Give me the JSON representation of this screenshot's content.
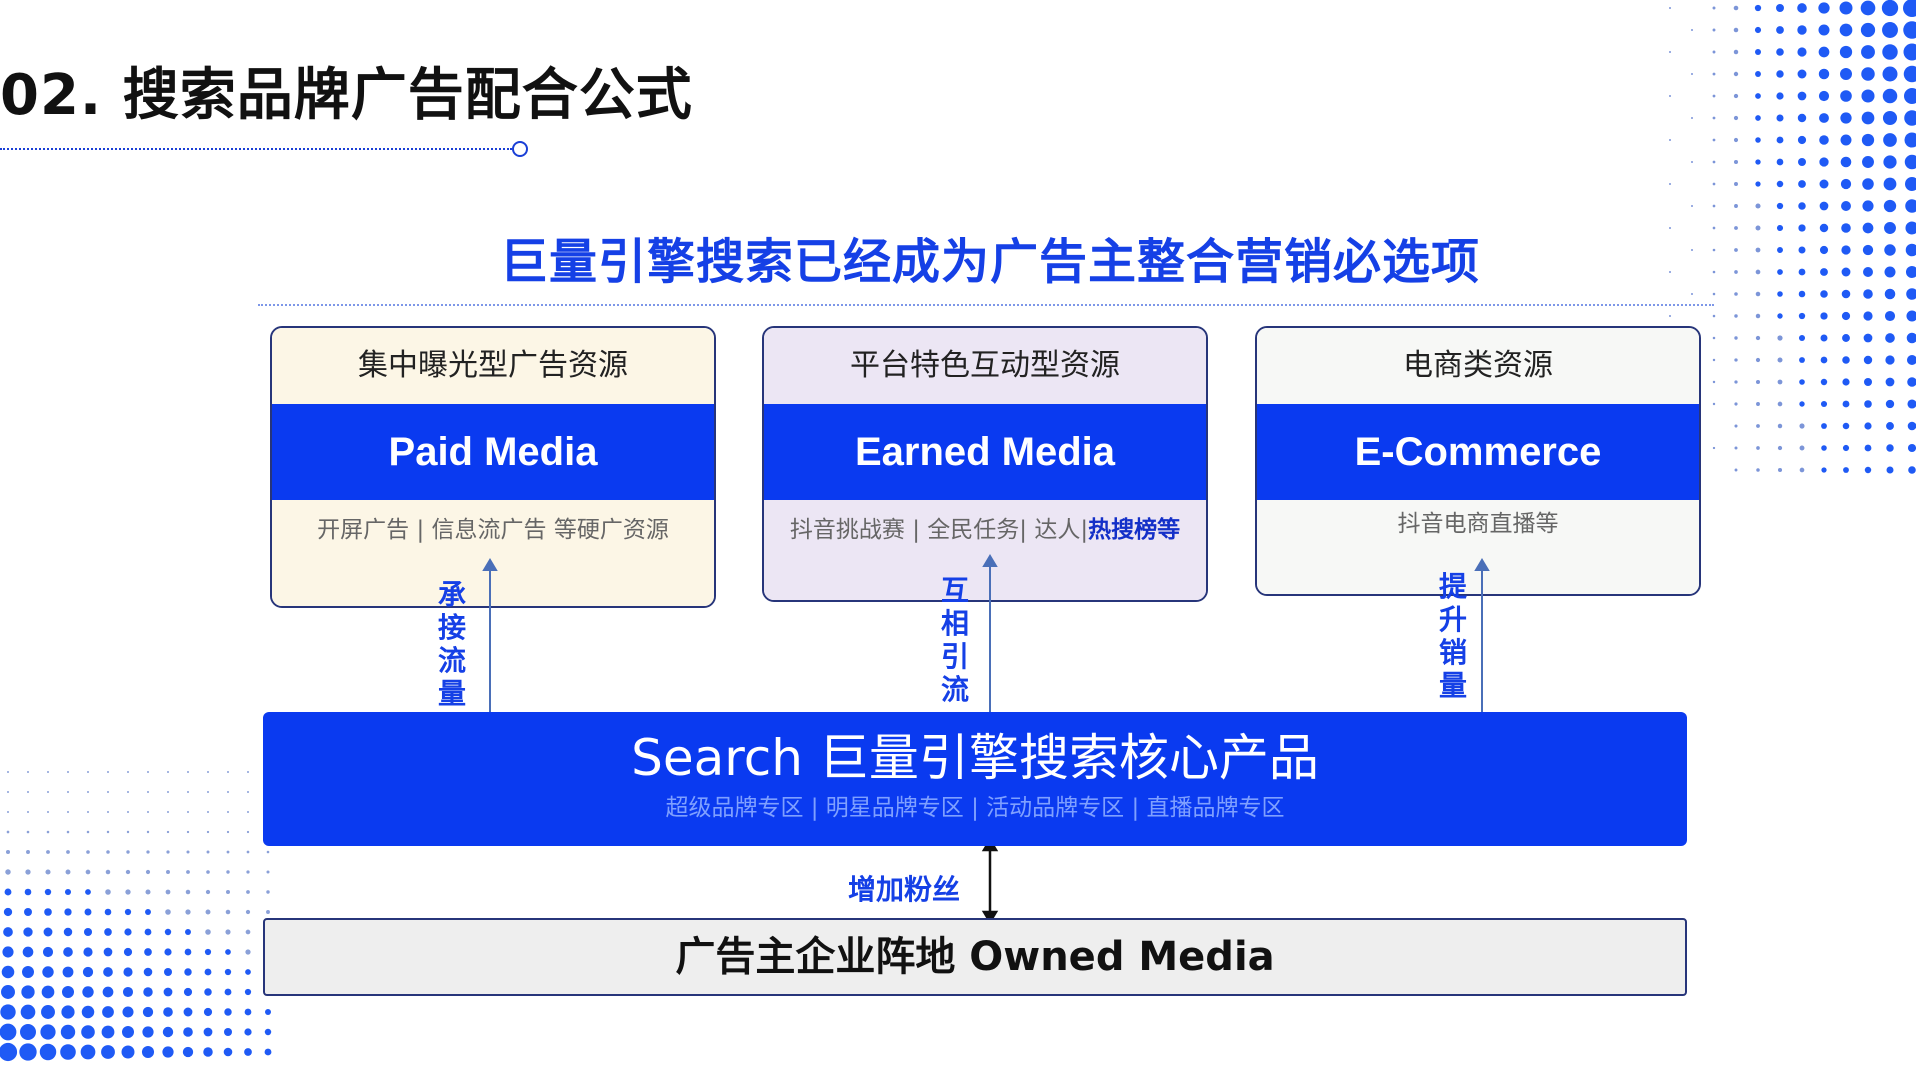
{
  "page_title": "02. 搜索品牌广告配合公式",
  "headline": "巨量引擎搜索已经成为广告主整合营销必选项",
  "cards": [
    {
      "top_label": "集中曝光型广告资源",
      "band_label": "Paid Media",
      "bottom_text": "开屏广告 | 信息流广告  等硬广资源",
      "bottom_highlight": "",
      "top_bg": "#fcf6e6",
      "bottom_bg": "#fcf6e6"
    },
    {
      "top_label": "平台特色互动型资源",
      "band_label": "Earned Media",
      "bottom_text": "抖音挑战赛 | 全民任务| 达人|",
      "bottom_highlight": "热搜榜等",
      "top_bg": "#ece6f4",
      "bottom_bg": "#ece6f4"
    },
    {
      "top_label": "电商类资源",
      "band_label": "E-Commerce",
      "bottom_text": "抖音电商直播等",
      "bottom_highlight": "",
      "top_bg": "#f7f8f6",
      "bottom_bg": "#f7f8f6"
    }
  ],
  "connector_labels": [
    "承接流量",
    "互相引流",
    "提升销量"
  ],
  "core": {
    "title": "Search 巨量引擎搜索核心产品",
    "subtitle": "超级品牌专区 | 明星品牌专区 | 活动品牌专区 | 直播品牌专区"
  },
  "fans_label": "增加粉丝",
  "owned_media": "广告主企业阵地 Owned Media",
  "colors": {
    "accent_blue": "#0a3af0",
    "headline_blue": "#1540e6",
    "border_navy": "#27357a",
    "arrow_blue": "#4a6fb8"
  }
}
